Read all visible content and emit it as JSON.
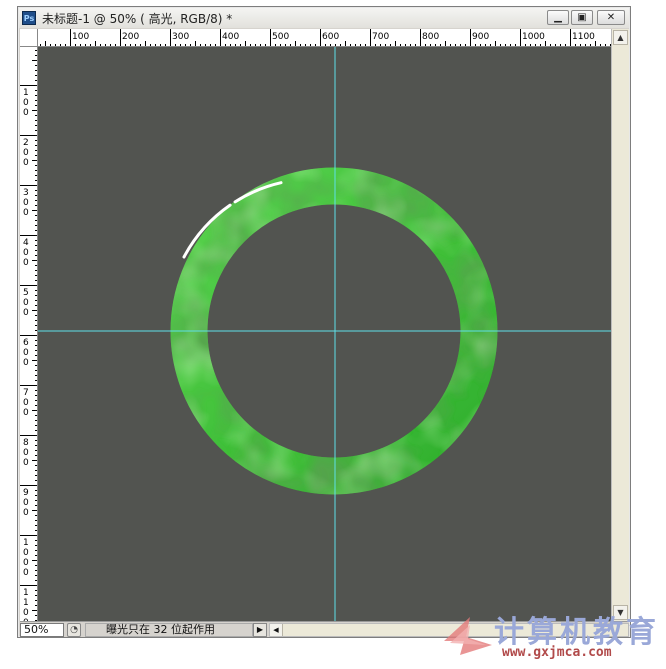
{
  "window": {
    "app_icon": "Ps",
    "title": "未标题-1 @ 50% ( 高光, RGB/8) *",
    "minimize_icon": "minimize-icon",
    "restore_icon": "restore-icon",
    "close_icon": "close-icon"
  },
  "ruler": {
    "h_labels": [
      "100",
      "200",
      "300",
      "400",
      "500",
      "600",
      "700",
      "800",
      "900",
      "1000",
      "1100"
    ],
    "v_labels": [
      "100",
      "200",
      "300",
      "400",
      "500",
      "600",
      "700",
      "800",
      "900",
      "1000",
      "1100"
    ]
  },
  "canvas": {
    "background": "#525450",
    "guide_color": "#5fe0e8",
    "ring_color": "#3fc23a",
    "ring_dark": "#0f6a10",
    "ring_light": "#9ef08f"
  },
  "status": {
    "zoom": "50%",
    "message": "曝光只在 32 位起作用"
  },
  "watermark": {
    "text": "计算机教育",
    "url": "www.gxjmca.com"
  }
}
